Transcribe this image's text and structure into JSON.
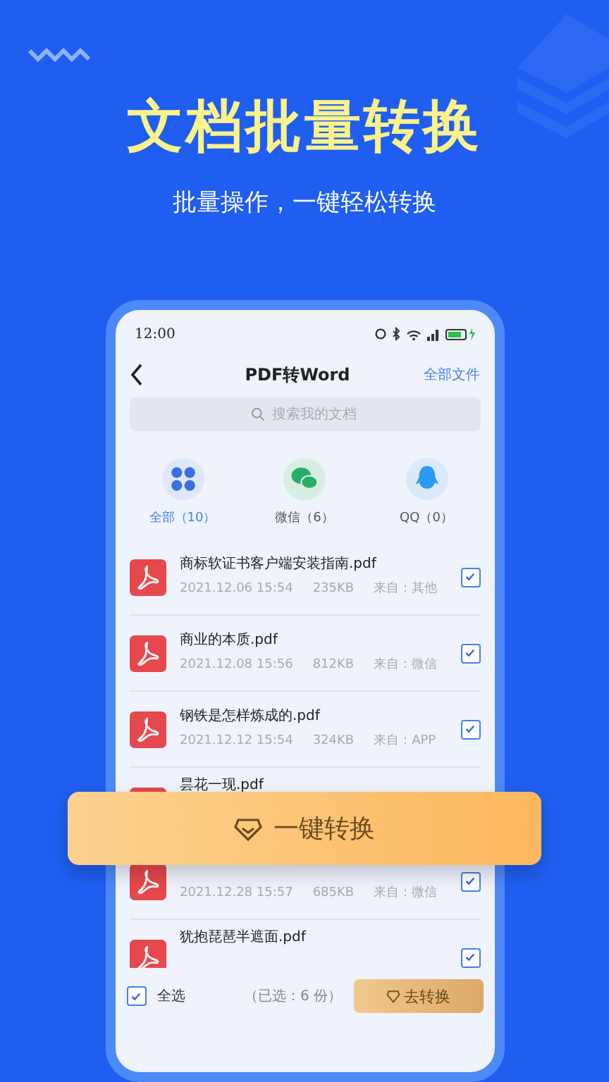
{
  "headline": "文档批量转换",
  "subheadline": "批量操作，一键轻松转换",
  "phone": {
    "status_bar": {
      "time": "12:00"
    },
    "nav": {
      "title": "PDF转Word",
      "action": "全部文件"
    },
    "search": {
      "placeholder": "搜索我的文档"
    },
    "tabs": [
      {
        "label": "全部（10）",
        "kind": "all",
        "selected": true
      },
      {
        "label": "微信（6）",
        "kind": "wechat",
        "selected": false
      },
      {
        "label": "QQ（0）",
        "kind": "qq",
        "selected": false
      }
    ],
    "files": [
      {
        "name": "商标软证书客户端安装指南.pdf",
        "date": "2021.12.06 15:54",
        "size": "235KB",
        "source": "来自：其他",
        "checked": true
      },
      {
        "name": "商业的本质.pdf",
        "date": "2021.12.08 15:56",
        "size": "812KB",
        "source": "来自：微信",
        "checked": true
      },
      {
        "name": "钢铁是怎样炼成的.pdf",
        "date": "2021.12.12 15:54",
        "size": "324KB",
        "source": "来自：APP",
        "checked": true
      },
      {
        "name": "昙花一现.pdf"
      },
      {
        "date": "2021.12.28 15:57",
        "size": "685KB",
        "source": "来自：微信",
        "checked": true
      },
      {
        "name": "犹抱琵琶半遮面.pdf",
        "checked": true
      }
    ],
    "bottom_bar": {
      "select_all": {
        "label": "全选",
        "checked": true
      },
      "selected_count": "（已选：6 份）",
      "convert_button": "去转换"
    }
  },
  "overlay_button": {
    "label": "一键转换"
  }
}
